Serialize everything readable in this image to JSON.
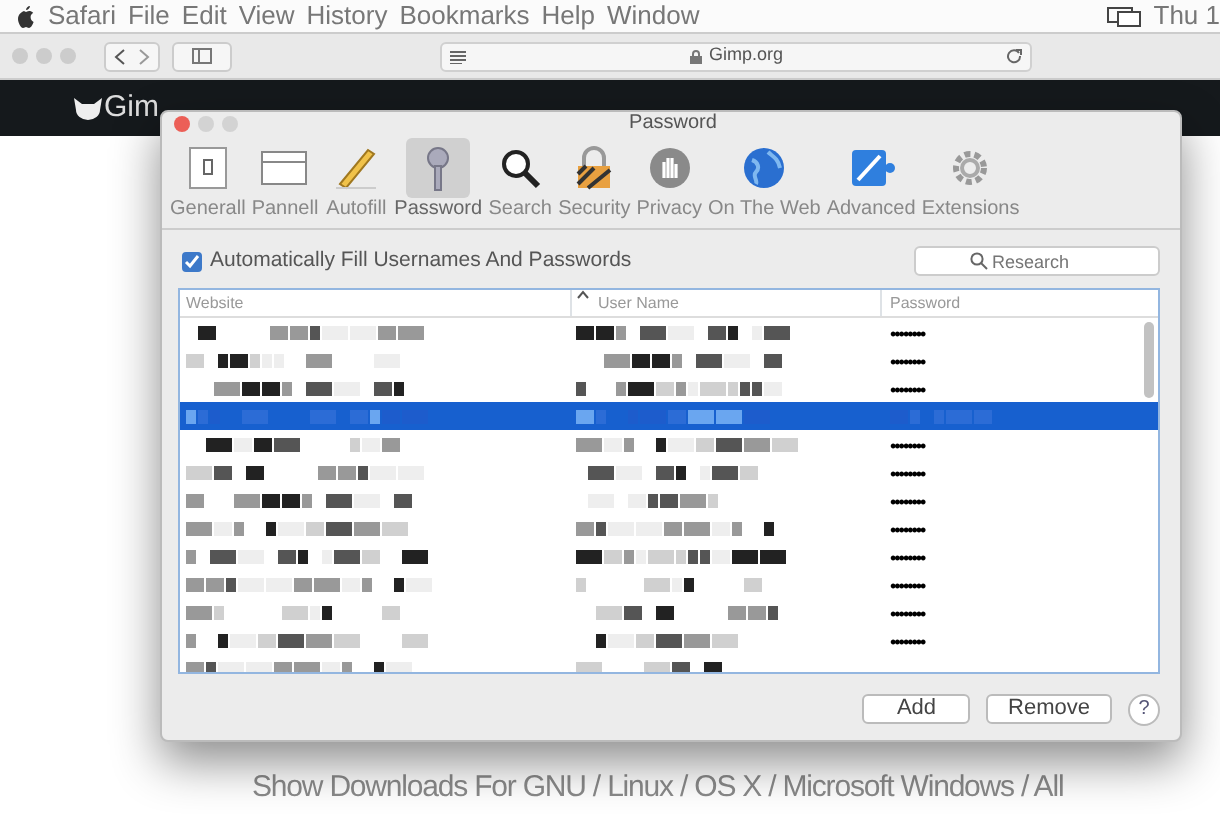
{
  "menu_bar": {
    "items": [
      "Safari",
      "File",
      "Edit",
      "View",
      "History",
      "Bookmarks",
      "Help",
      "Window"
    ],
    "clock": "Thu 1"
  },
  "browser": {
    "address": "Gimp.org"
  },
  "site_nav": {
    "logo": "Gim"
  },
  "dialog": {
    "title": "Password",
    "tabs": [
      {
        "label": "Generall",
        "selected": false
      },
      {
        "label": "Pannell",
        "selected": false
      },
      {
        "label": "Autofill",
        "selected": false
      },
      {
        "label": "Password",
        "selected": true
      },
      {
        "label": "Search",
        "selected": false
      },
      {
        "label": "Security",
        "selected": false
      },
      {
        "label": "Privacy",
        "selected": false
      },
      {
        "label": "On The Web",
        "selected": false
      },
      {
        "label": "Advanced",
        "selected": false
      },
      {
        "label": "Extensions",
        "selected": false
      }
    ],
    "autofill": {
      "label": "Automatically Fill Usernames And Passwords",
      "checked": true
    },
    "search": {
      "placeholder": "Research"
    },
    "table": {
      "columns": [
        "Website",
        "User Name",
        "Password"
      ],
      "rows": [
        {
          "selected": false,
          "password": "••••••••"
        },
        {
          "selected": false,
          "password": "••••••••"
        },
        {
          "selected": false,
          "password": "••••••••"
        },
        {
          "selected": true
        },
        {
          "selected": false,
          "password": "••••••••"
        },
        {
          "selected": false,
          "password": "••••••••"
        },
        {
          "selected": false,
          "password": "••••••••"
        },
        {
          "selected": false,
          "password": "••••••••"
        },
        {
          "selected": false,
          "password": "••••••••"
        },
        {
          "selected": false,
          "password": "••••••••"
        },
        {
          "selected": false,
          "password": "••••••••"
        },
        {
          "selected": false,
          "password": "••••••••"
        },
        {
          "selected": false
        }
      ]
    },
    "buttons": [
      "Add",
      "Remove",
      "?"
    ]
  },
  "page_text": "Show Downloads For GNU / Linux / OS X / Microsoft Windows / All"
}
